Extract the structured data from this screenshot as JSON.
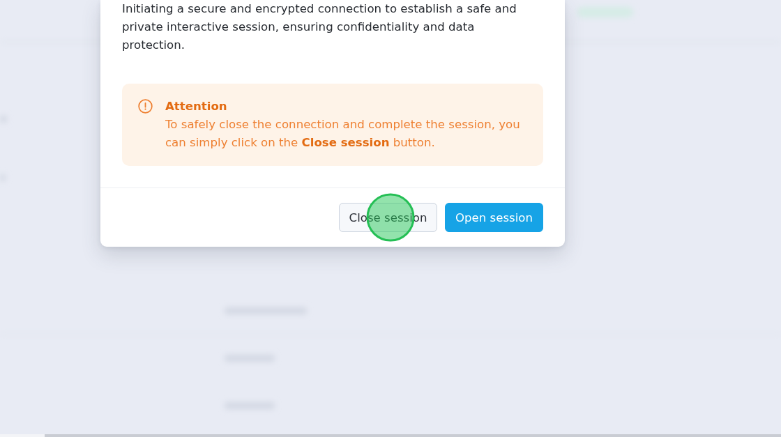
{
  "dialog": {
    "description": "Initiating a secure and encrypted connection to establish a safe and private interactive session, ensuring confidentiality and data protection.",
    "alert": {
      "kind": "warning",
      "title": "Attention",
      "message": "To safely close the connection and complete the session, you can simply click on the **Close session** button."
    },
    "buttons": [
      {
        "label": "Close session",
        "kind": "secondary",
        "clicked": true
      },
      {
        "label": "Open session",
        "kind": "primary",
        "clicked": false
      }
    ]
  }
}
